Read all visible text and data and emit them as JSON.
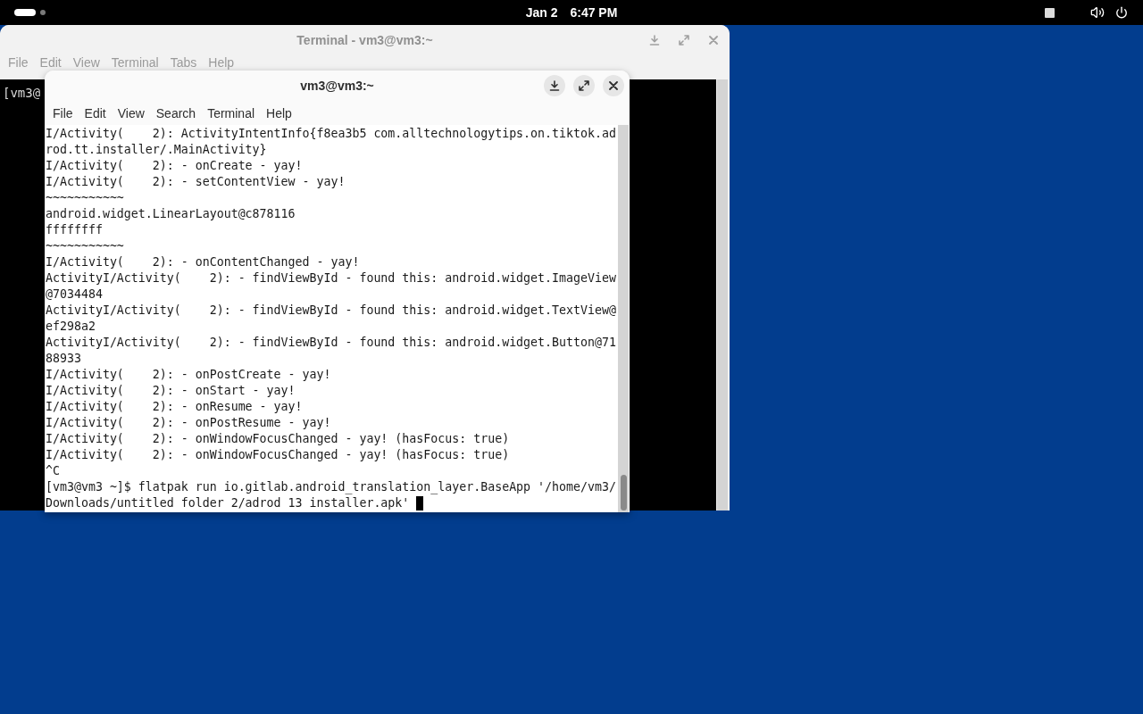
{
  "top_bar": {
    "workspaces": [
      {
        "selected": true
      },
      {
        "selected": false
      }
    ],
    "date": "Jan 2",
    "time": "6:47 PM"
  },
  "back_window": {
    "title": "Terminal - vm3@vm3:~",
    "focused": false,
    "menu": [
      "File",
      "Edit",
      "View",
      "Terminal",
      "Tabs",
      "Help"
    ],
    "visible_text": "[vm3@"
  },
  "front_window": {
    "title": "vm3@vm3:~",
    "focused": true,
    "menu": [
      "File",
      "Edit",
      "View",
      "Search",
      "Terminal",
      "Help"
    ],
    "lines": [
      "I/Activity(    2): ActivityIntentInfo{f8ea3b5 com.alltechnologytips.on.tiktok.ad",
      "rod.tt.installer/.MainActivity}",
      "I/Activity(    2): - onCreate - yay!",
      "I/Activity(    2): - setContentView - yay!",
      "~~~~~~~~~~~",
      "android.widget.LinearLayout@c878116",
      "ffffffff",
      "~~~~~~~~~~~",
      "I/Activity(    2): - onContentChanged - yay!",
      "ActivityI/Activity(    2): - findViewById - found this: android.widget.ImageView",
      "@7034484",
      "ActivityI/Activity(    2): - findViewById - found this: android.widget.TextView@",
      "ef298a2",
      "ActivityI/Activity(    2): - findViewById - found this: android.widget.Button@71",
      "88933",
      "I/Activity(    2): - onPostCreate - yay!",
      "I/Activity(    2): - onStart - yay!",
      "I/Activity(    2): - onResume - yay!",
      "I/Activity(    2): - onPostResume - yay!",
      "I/Activity(    2): - onWindowFocusChanged - yay! (hasFocus: true)",
      "I/Activity(    2): - onWindowFocusChanged - yay! (hasFocus: true)",
      "^C",
      "[vm3@vm3 ~]$ flatpak run io.gitlab.android_translation_layer.BaseApp '/home/vm3/",
      "Downloads/untitled folder 2/adrod 13 installer.apk'"
    ]
  }
}
